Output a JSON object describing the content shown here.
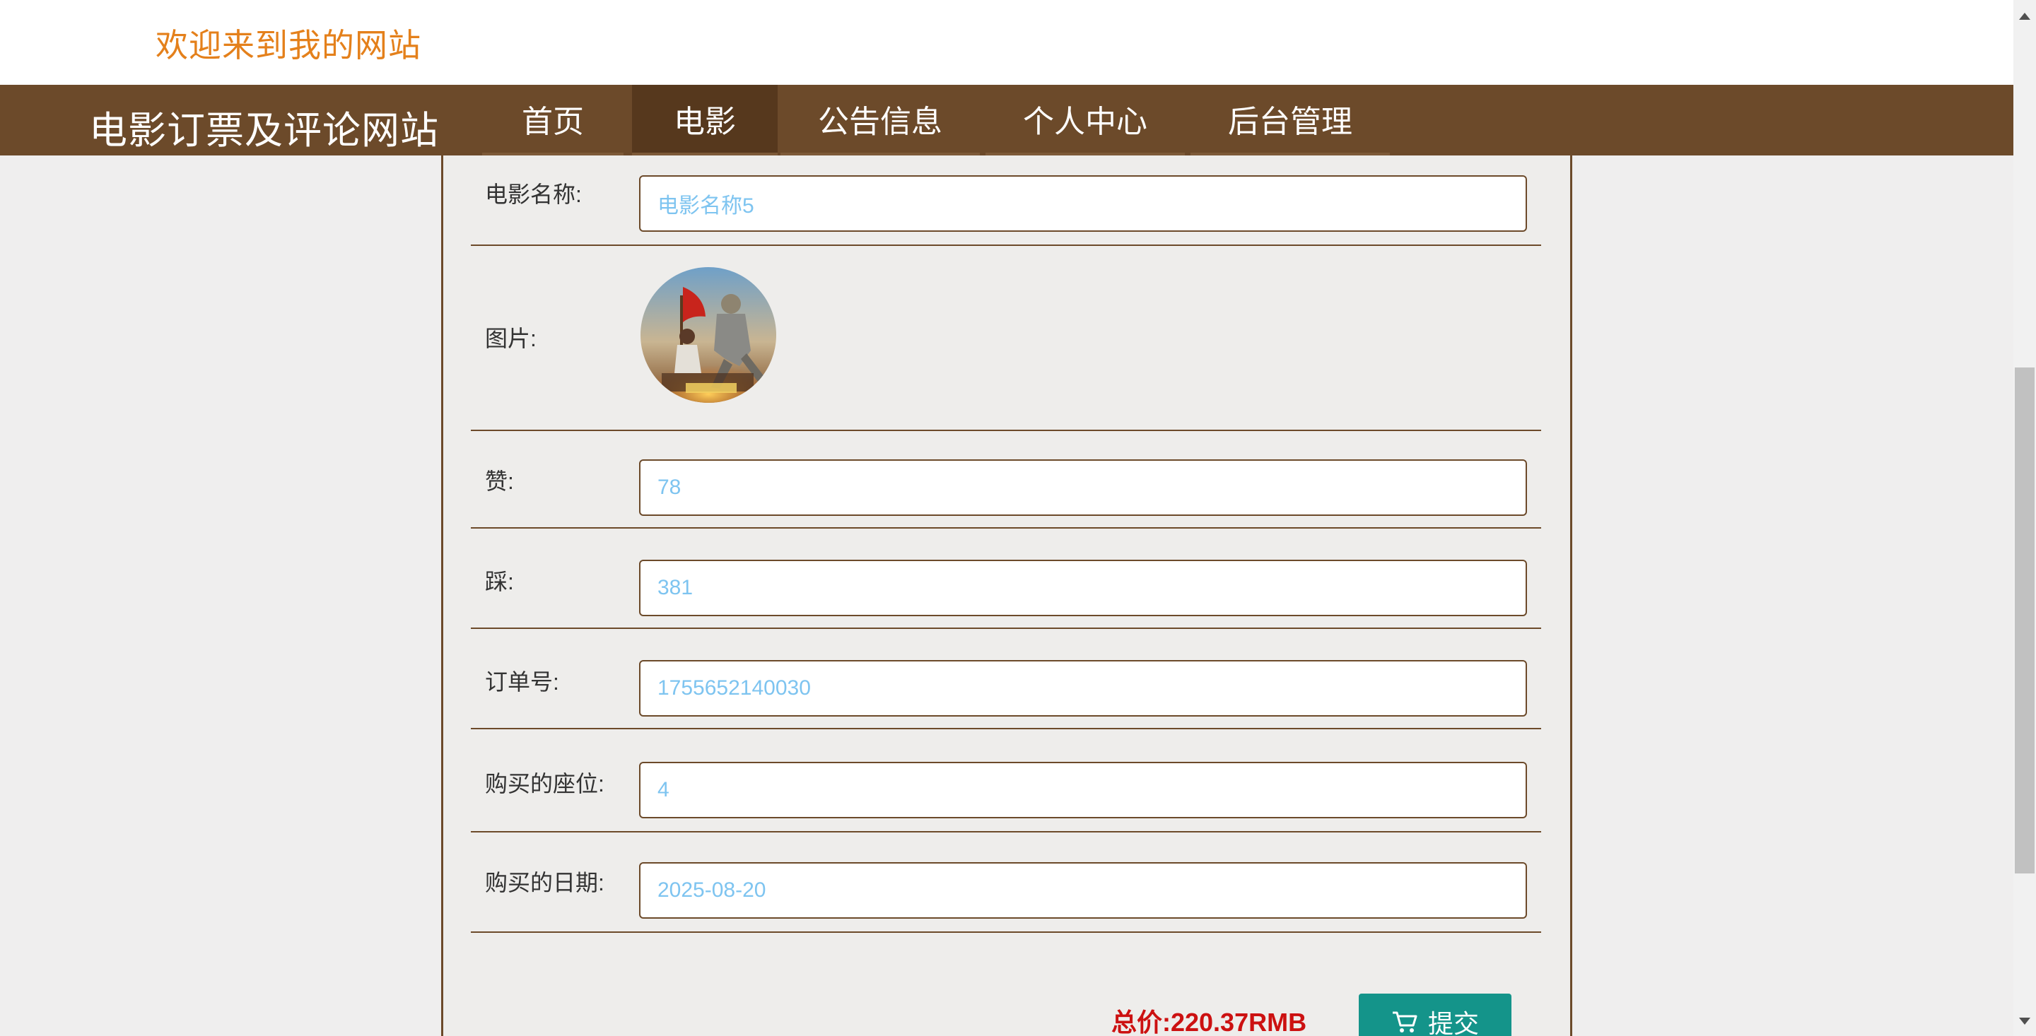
{
  "header": {
    "welcome": "欢迎来到我的网站",
    "brand": "电影订票及评论网站"
  },
  "nav": {
    "items": [
      {
        "label": "首页",
        "active": false
      },
      {
        "label": "电影",
        "active": true
      },
      {
        "label": "公告信息",
        "active": false
      },
      {
        "label": "个人中心",
        "active": false
      },
      {
        "label": "后台管理",
        "active": false
      }
    ]
  },
  "form": {
    "movie_name": {
      "label": "电影名称:",
      "value": "电影名称5"
    },
    "image": {
      "label": "图片:"
    },
    "likes": {
      "label": "赞:",
      "value": "78"
    },
    "dislikes": {
      "label": "踩:",
      "value": "381"
    },
    "order_no": {
      "label": "订单号:",
      "value": "1755652140030"
    },
    "seat": {
      "label": "购买的座位:",
      "value": "4"
    },
    "date": {
      "label": "购买的日期:",
      "value": "2025-08-20"
    }
  },
  "footer": {
    "total": "总价:220.37RMB",
    "submit_label": "提交"
  },
  "colors": {
    "brand_brown": "#6c4a2a",
    "active_nav": "#56381d",
    "welcome_orange": "#e4801b",
    "submit_teal": "#14948a",
    "total_red": "#cc1111",
    "input_text": "#7ec4f0"
  },
  "icons": {
    "submit": "cart-icon"
  }
}
